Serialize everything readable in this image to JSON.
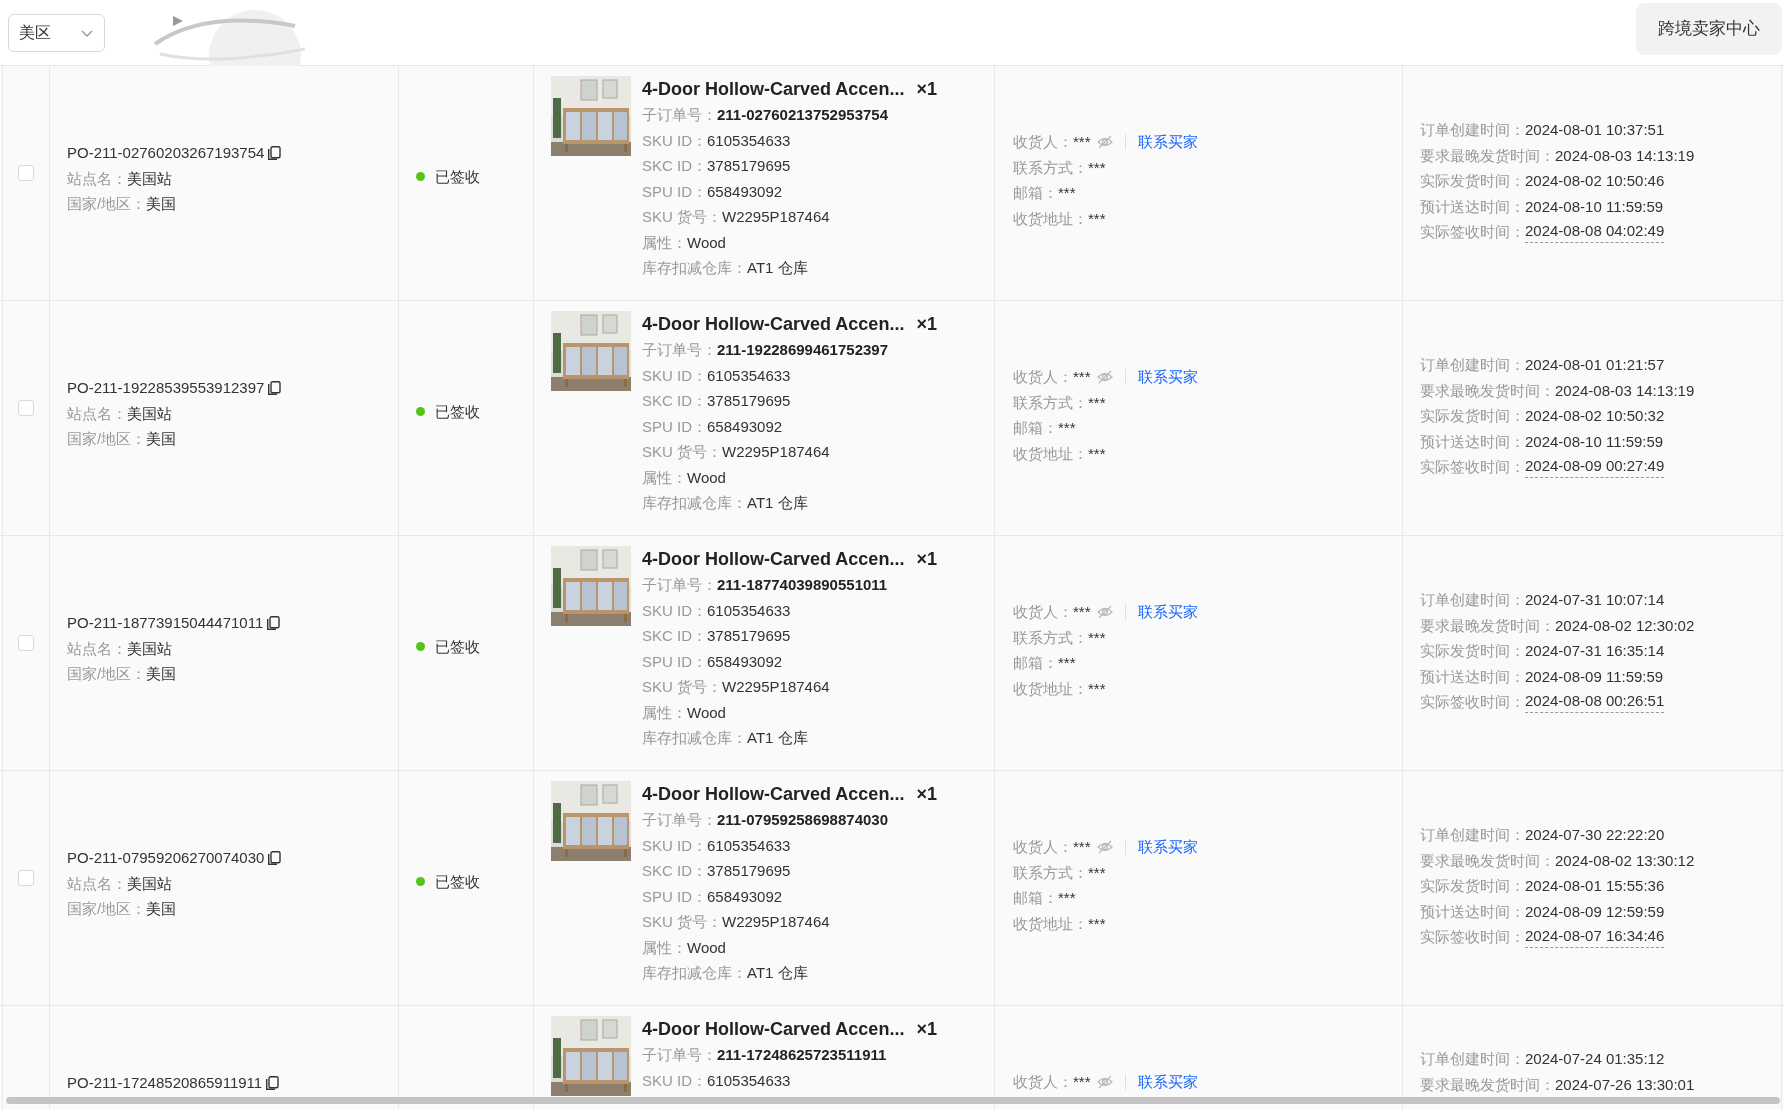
{
  "region_select": {
    "value": "美区"
  },
  "seller_center_button": "跨境卖家中心",
  "orders": [
    {
      "checked": false,
      "order_id": "PO-211-02760203267193754",
      "site": {
        "label": "站点名：",
        "value": "美国站"
      },
      "region": {
        "label": "国家/地区：",
        "value": "美国"
      },
      "status": {
        "text": "已签收",
        "color": "#52c41a"
      },
      "product": {
        "title": "4-Door Hollow-Carved Accen...",
        "quantity": "×1",
        "sub_order": {
          "label": "子订单号：",
          "value": "211-02760213752953754"
        },
        "details": [
          {
            "label": "SKU ID：",
            "value": "6105354633"
          },
          {
            "label": "SKC ID：",
            "value": "3785179695"
          },
          {
            "label": "SPU ID：",
            "value": "658493092"
          },
          {
            "label": "SKU 货号：",
            "value": "W2295P187464"
          },
          {
            "label": "属性：",
            "value": "Wood"
          },
          {
            "label": "库存扣减仓库：",
            "value": "AT1 仓库"
          }
        ]
      },
      "recipient": {
        "fields": [
          {
            "label": "收货人：",
            "value": "***"
          },
          {
            "label": "联系方式：",
            "value": "***"
          },
          {
            "label": "邮箱：",
            "value": "***"
          },
          {
            "label": "收货地址：",
            "value": "***"
          }
        ],
        "contact_link": "联系买家"
      },
      "times": [
        {
          "label": "订单创建时间：",
          "value": "2024-08-01 10:37:51",
          "underlined": false
        },
        {
          "label": "要求最晚发货时间：",
          "value": "2024-08-03 14:13:19",
          "underlined": false
        },
        {
          "label": "实际发货时间：",
          "value": "2024-08-02 10:50:46",
          "underlined": false
        },
        {
          "label": "预计送达时间：",
          "value": "2024-08-10 11:59:59",
          "underlined": false
        },
        {
          "label": "实际签收时间：",
          "value": "2024-08-08 04:02:49",
          "underlined": true
        }
      ]
    },
    {
      "checked": false,
      "order_id": "PO-211-19228539553912397",
      "site": {
        "label": "站点名：",
        "value": "美国站"
      },
      "region": {
        "label": "国家/地区：",
        "value": "美国"
      },
      "status": {
        "text": "已签收",
        "color": "#52c41a"
      },
      "product": {
        "title": "4-Door Hollow-Carved Accen...",
        "quantity": "×1",
        "sub_order": {
          "label": "子订单号：",
          "value": "211-19228699461752397"
        },
        "details": [
          {
            "label": "SKU ID：",
            "value": "6105354633"
          },
          {
            "label": "SKC ID：",
            "value": "3785179695"
          },
          {
            "label": "SPU ID：",
            "value": "658493092"
          },
          {
            "label": "SKU 货号：",
            "value": "W2295P187464"
          },
          {
            "label": "属性：",
            "value": "Wood"
          },
          {
            "label": "库存扣减仓库：",
            "value": "AT1 仓库"
          }
        ]
      },
      "recipient": {
        "fields": [
          {
            "label": "收货人：",
            "value": "***"
          },
          {
            "label": "联系方式：",
            "value": "***"
          },
          {
            "label": "邮箱：",
            "value": "***"
          },
          {
            "label": "收货地址：",
            "value": "***"
          }
        ],
        "contact_link": "联系买家"
      },
      "times": [
        {
          "label": "订单创建时间：",
          "value": "2024-08-01 01:21:57",
          "underlined": false
        },
        {
          "label": "要求最晚发货时间：",
          "value": "2024-08-03 14:13:19",
          "underlined": false
        },
        {
          "label": "实际发货时间：",
          "value": "2024-08-02 10:50:32",
          "underlined": false
        },
        {
          "label": "预计送达时间：",
          "value": "2024-08-10 11:59:59",
          "underlined": false
        },
        {
          "label": "实际签收时间：",
          "value": "2024-08-09 00:27:49",
          "underlined": true
        }
      ]
    },
    {
      "checked": false,
      "order_id": "PO-211-18773915044471011",
      "site": {
        "label": "站点名：",
        "value": "美国站"
      },
      "region": {
        "label": "国家/地区：",
        "value": "美国"
      },
      "status": {
        "text": "已签收",
        "color": "#52c41a"
      },
      "product": {
        "title": "4-Door Hollow-Carved Accen...",
        "quantity": "×1",
        "sub_order": {
          "label": "子订单号：",
          "value": "211-18774039890551011"
        },
        "details": [
          {
            "label": "SKU ID：",
            "value": "6105354633"
          },
          {
            "label": "SKC ID：",
            "value": "3785179695"
          },
          {
            "label": "SPU ID：",
            "value": "658493092"
          },
          {
            "label": "SKU 货号：",
            "value": "W2295P187464"
          },
          {
            "label": "属性：",
            "value": "Wood"
          },
          {
            "label": "库存扣减仓库：",
            "value": "AT1 仓库"
          }
        ]
      },
      "recipient": {
        "fields": [
          {
            "label": "收货人：",
            "value": "***"
          },
          {
            "label": "联系方式：",
            "value": "***"
          },
          {
            "label": "邮箱：",
            "value": "***"
          },
          {
            "label": "收货地址：",
            "value": "***"
          }
        ],
        "contact_link": "联系买家"
      },
      "times": [
        {
          "label": "订单创建时间：",
          "value": "2024-07-31 10:07:14",
          "underlined": false
        },
        {
          "label": "要求最晚发货时间：",
          "value": "2024-08-02 12:30:02",
          "underlined": false
        },
        {
          "label": "实际发货时间：",
          "value": "2024-07-31 16:35:14",
          "underlined": false
        },
        {
          "label": "预计送达时间：",
          "value": "2024-08-09 11:59:59",
          "underlined": false
        },
        {
          "label": "实际签收时间：",
          "value": "2024-08-08 00:26:51",
          "underlined": true
        }
      ]
    },
    {
      "checked": false,
      "order_id": "PO-211-07959206270074030",
      "site": {
        "label": "站点名：",
        "value": "美国站"
      },
      "region": {
        "label": "国家/地区：",
        "value": "美国"
      },
      "status": {
        "text": "已签收",
        "color": "#52c41a"
      },
      "product": {
        "title": "4-Door Hollow-Carved Accen...",
        "quantity": "×1",
        "sub_order": {
          "label": "子订单号：",
          "value": "211-07959258698874030"
        },
        "details": [
          {
            "label": "SKU ID：",
            "value": "6105354633"
          },
          {
            "label": "SKC ID：",
            "value": "3785179695"
          },
          {
            "label": "SPU ID：",
            "value": "658493092"
          },
          {
            "label": "SKU 货号：",
            "value": "W2295P187464"
          },
          {
            "label": "属性：",
            "value": "Wood"
          },
          {
            "label": "库存扣减仓库：",
            "value": "AT1 仓库"
          }
        ]
      },
      "recipient": {
        "fields": [
          {
            "label": "收货人：",
            "value": "***"
          },
          {
            "label": "联系方式：",
            "value": "***"
          },
          {
            "label": "邮箱：",
            "value": "***"
          },
          {
            "label": "收货地址：",
            "value": "***"
          }
        ],
        "contact_link": "联系买家"
      },
      "times": [
        {
          "label": "订单创建时间：",
          "value": "2024-07-30 22:22:20",
          "underlined": false
        },
        {
          "label": "要求最晚发货时间：",
          "value": "2024-08-02 13:30:12",
          "underlined": false
        },
        {
          "label": "实际发货时间：",
          "value": "2024-08-01 15:55:36",
          "underlined": false
        },
        {
          "label": "预计送达时间：",
          "value": "2024-08-09 12:59:59",
          "underlined": false
        },
        {
          "label": "实际签收时间：",
          "value": "2024-08-07 16:34:46",
          "underlined": true
        }
      ]
    },
    {
      "order_id": "PO-211-17248520865911911",
      "product": {
        "title": "4-Door Hollow-Carved Accen...",
        "quantity": "×1",
        "sub_order": {
          "label": "子订单号：",
          "value": "211-17248625723511911"
        },
        "details": [
          {
            "label": "SKU ID：",
            "value": "6105354633"
          }
        ]
      },
      "recipient": {
        "fields": [
          {
            "label": "收货人：",
            "value": "***"
          }
        ],
        "contact_link": "联系买家"
      },
      "times": [
        {
          "label": "订单创建时间：",
          "value": "2024-07-24 01:35:12",
          "underlined": false
        },
        {
          "label": "要求最晚发货时间：",
          "value": "2024-07-26 13:30:01",
          "underlined": false
        }
      ]
    }
  ]
}
